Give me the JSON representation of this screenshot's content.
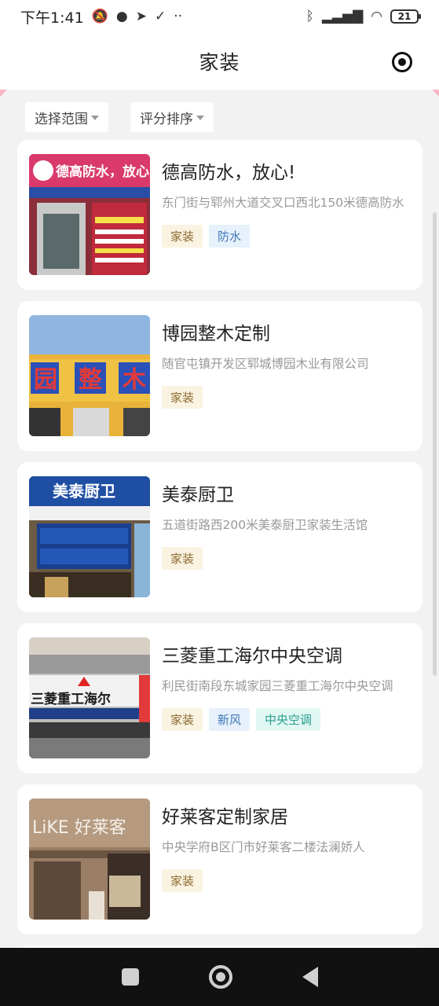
{
  "status_bar": {
    "time": "下午1:41",
    "left_icons": [
      "mute-icon",
      "chat-icon",
      "telegram-icon",
      "check-icon",
      "more-icon"
    ],
    "right_icons": [
      "bluetooth-icon",
      "signal-icon",
      "wifi-icon",
      "battery-icon"
    ],
    "battery": "21"
  },
  "header": {
    "title": "家装"
  },
  "filters": [
    {
      "label": "选择范围"
    },
    {
      "label": "评分排序"
    }
  ],
  "stores": [
    {
      "name": "德高防水，放心!",
      "address": "东门街与郓州大道交叉口西北150米德高防水",
      "tags": [
        "家装",
        "防水"
      ],
      "thumb_sign": "德高防水，放心!"
    },
    {
      "name": "博园整木定制",
      "address": "随官屯镇开发区郓城博园木业有限公司",
      "tags": [
        "家装"
      ],
      "thumb_sign": "园 整 木"
    },
    {
      "name": "美泰厨卫",
      "address": "五道街路西200米美泰厨卫家装生活馆",
      "tags": [
        "家装"
      ],
      "thumb_sign": "美泰厨卫"
    },
    {
      "name": "三菱重工海尔中央空调",
      "address": "利民街南段东城家园三菱重工海尔中央空调",
      "tags": [
        "家装",
        "新风",
        "中央空调"
      ],
      "thumb_sign": "三菱重工海尔"
    },
    {
      "name": "好莱客定制家居",
      "address": "中央学府B区门市好莱客二楼法澜娇人",
      "tags": [
        "家装"
      ],
      "thumb_sign": "LiKE 好莱客"
    }
  ],
  "colors": {
    "tag_decoration": "#fbf3e2",
    "tag_blue": "#e7f1fb",
    "tag_teal": "#e1f7f3"
  }
}
